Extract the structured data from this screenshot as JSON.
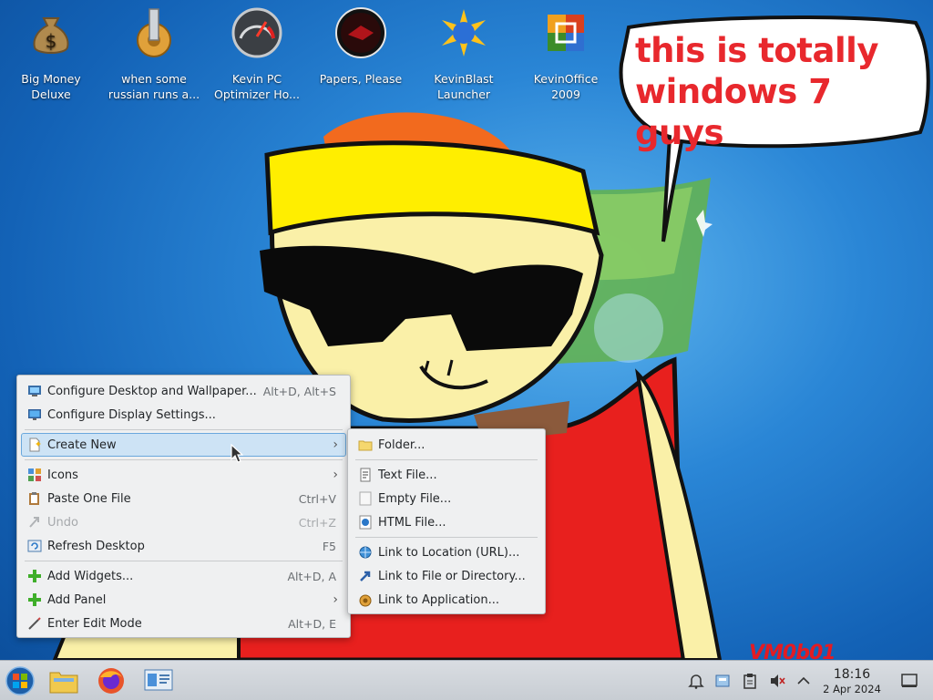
{
  "desktop_icons": [
    {
      "icon": "money-bag-icon",
      "label": "Big Money Deluxe"
    },
    {
      "icon": "gear-tower-icon",
      "label": "when some russian runs a..."
    },
    {
      "icon": "speedometer-icon",
      "label": "Kevin PC Optimizer Ho..."
    },
    {
      "icon": "papers-please-icon",
      "label": "Papers, Please"
    },
    {
      "icon": "kevinblast-icon",
      "label": "KevinBlast Launcher"
    },
    {
      "icon": "office-icon",
      "label": "KevinOffice 2009"
    }
  ],
  "wallpaper": {
    "bubble_text": "this is totally windows 7 guys",
    "signature": "VM0b01"
  },
  "context_menu": {
    "items": [
      {
        "label": "Configure Desktop and Wallpaper...",
        "shortcut": "Alt+D, Alt+S",
        "icon": "desktop-settings-icon"
      },
      {
        "label": "Configure Display Settings...",
        "shortcut": "",
        "icon": "display-icon"
      },
      {
        "label": "Create New",
        "shortcut": "",
        "icon": "new-document-icon"
      },
      {
        "label": "Icons",
        "shortcut": "",
        "icon": "icons-grid-icon"
      },
      {
        "label": "Paste One File",
        "shortcut": "Ctrl+V",
        "icon": "paste-icon"
      },
      {
        "label": "Undo",
        "shortcut": "Ctrl+Z",
        "icon": "undo-icon"
      },
      {
        "label": "Refresh Desktop",
        "shortcut": "F5",
        "icon": "refresh-icon"
      },
      {
        "label": "Add Widgets...",
        "shortcut": "Alt+D, A",
        "icon": "add-icon"
      },
      {
        "label": "Add Panel",
        "shortcut": "",
        "icon": "add-icon"
      },
      {
        "label": "Enter Edit Mode",
        "shortcut": "Alt+D, E",
        "icon": "edit-icon"
      }
    ]
  },
  "create_new_submenu": {
    "items": [
      {
        "label": "Folder...",
        "icon": "folder-icon"
      },
      {
        "label": "Text File...",
        "icon": "text-file-icon"
      },
      {
        "label": "Empty File...",
        "icon": "empty-file-icon"
      },
      {
        "label": "HTML File...",
        "icon": "html-file-icon"
      },
      {
        "label": "Link to Location (URL)...",
        "icon": "url-link-icon"
      },
      {
        "label": "Link to File or Directory...",
        "icon": "file-link-icon"
      },
      {
        "label": "Link to Application...",
        "icon": "app-link-icon"
      }
    ]
  },
  "taskbar": {
    "start_icon": "start-orb-icon",
    "pinned": [
      {
        "icon": "file-manager-icon"
      },
      {
        "icon": "firefox-icon"
      },
      {
        "icon": "system-settings-icon"
      }
    ],
    "tray": [
      {
        "icon": "notifications-bell-icon"
      },
      {
        "icon": "device-notifier-icon"
      },
      {
        "icon": "clipboard-icon"
      },
      {
        "icon": "volume-muted-icon"
      },
      {
        "icon": "tray-expand-icon"
      }
    ],
    "clock_time": "18:16",
    "clock_date": "2 Apr 2024",
    "show_desktop_icon": "show-desktop-icon"
  },
  "colors": {
    "bubble_text": "#e8282d",
    "menu_bg": "#eff0f1",
    "menu_highlight": "#cde3f5",
    "taskbar": "#d3d7dc"
  }
}
